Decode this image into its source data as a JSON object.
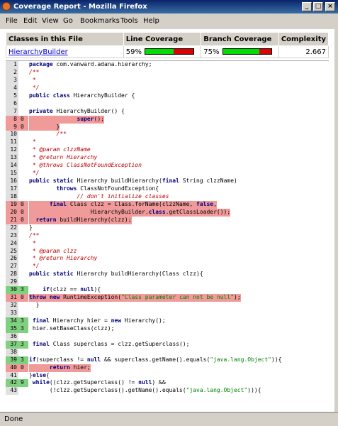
{
  "window": {
    "title": "Coverage Report - Mozilla Firefox"
  },
  "menubar": {
    "items": [
      "File",
      "Edit",
      "View",
      "Go",
      "Bookmarks",
      "Tools",
      "Help"
    ]
  },
  "summary": {
    "headers": [
      "Classes in this File",
      "Line Coverage",
      "Branch Coverage",
      "Complexity"
    ],
    "class_name": "HierarchyBuilder",
    "line_coverage": {
      "text": "59%",
      "fraction": 0.59
    },
    "branch_coverage": {
      "text": "75%",
      "fraction": 0.75
    },
    "complexity": "2.667"
  },
  "code_lines": [
    {
      "n": "1",
      "h": "",
      "s": "",
      "t": "<span class='kw'>package</span> com.vanward.adana.hierarchy;"
    },
    {
      "n": "2",
      "h": "",
      "s": "",
      "t": "<span class='cm'>/**</span>"
    },
    {
      "n": "3",
      "h": "",
      "s": "",
      "t": "<span class='cm'> *</span>"
    },
    {
      "n": "4",
      "h": "",
      "s": "",
      "t": "<span class='cm'> */</span>"
    },
    {
      "n": "5",
      "h": "",
      "s": "",
      "t": "<span class='kw'>public class</span> HierarchyBuilder {"
    },
    {
      "n": "6",
      "h": "",
      "s": "",
      "t": ""
    },
    {
      "n": "7",
      "h": "",
      "s": "",
      "t": "<span class='kw'>private</span> HierarchyBuilder() {"
    },
    {
      "n": "8",
      "h": "0",
      "s": "miss",
      "t": "              <span class='kw'>super</span>();"
    },
    {
      "n": "9",
      "h": "0",
      "s": "miss",
      "t": "        }"
    },
    {
      "n": "10",
      "h": "",
      "s": "",
      "t": "        <span class='cm'>/**</span>"
    },
    {
      "n": "11",
      "h": "",
      "s": "",
      "t": "<span class='cm'> *</span>"
    },
    {
      "n": "12",
      "h": "",
      "s": "",
      "t": "<span class='cm'> * @param clzzName</span>"
    },
    {
      "n": "13",
      "h": "",
      "s": "",
      "t": "<span class='cm'> * @return Hierarchy</span>"
    },
    {
      "n": "14",
      "h": "",
      "s": "",
      "t": "<span class='cm'> * @throws ClassNotFoundException</span>"
    },
    {
      "n": "15",
      "h": "",
      "s": "",
      "t": "<span class='cm'> */</span>"
    },
    {
      "n": "16",
      "h": "",
      "s": "",
      "t": "<span class='kw'>public static</span> Hierarchy buildHierarchy(<span class='kw'>final</span> String clzzName)"
    },
    {
      "n": "17",
      "h": "",
      "s": "",
      "t": "        <span class='kw'>throws</span> ClassNotFoundException{"
    },
    {
      "n": "18",
      "h": "",
      "s": "",
      "t": "              <span class='cm'>// don't initialize classes</span>"
    },
    {
      "n": "19",
      "h": "0",
      "s": "miss",
      "t": "      <span class='kw'>final</span> Class clzz = Class.forName(clzzName, <span class='kw'>false</span>,"
    },
    {
      "n": "20",
      "h": "0",
      "s": "miss",
      "t": "                  HierarchyBuilder.<span class='kw'>class</span>.getClassLoader());"
    },
    {
      "n": "21",
      "h": "0",
      "s": "miss",
      "t": "  <span class='kw'>return</span> buildHierarchy(clzz);"
    },
    {
      "n": "22",
      "h": "",
      "s": "",
      "t": "}"
    },
    {
      "n": "23",
      "h": "",
      "s": "",
      "t": "<span class='cm'>/**</span>"
    },
    {
      "n": "24",
      "h": "",
      "s": "",
      "t": "<span class='cm'> *</span>"
    },
    {
      "n": "25",
      "h": "",
      "s": "",
      "t": "<span class='cm'> * @param clzz</span>"
    },
    {
      "n": "26",
      "h": "",
      "s": "",
      "t": "<span class='cm'> * @return Hierarchy</span>"
    },
    {
      "n": "27",
      "h": "",
      "s": "",
      "t": "<span class='cm'> */</span>"
    },
    {
      "n": "28",
      "h": "",
      "s": "",
      "t": "<span class='kw'>public static</span> Hierarchy buildHierarchy(Class clzz){"
    },
    {
      "n": "29",
      "h": "",
      "s": "",
      "t": ""
    },
    {
      "n": "30",
      "h": "3",
      "s": "hit",
      "t": "    <span class='kw'>if</span>(clzz == <span class='kw'>null</span>){"
    },
    {
      "n": "31",
      "h": "0",
      "s": "miss",
      "t": "<span class='kw'>throw new</span> RuntimeException(<span class='st'>\"Class parameter can not be null\"</span>);"
    },
    {
      "n": "32",
      "h": "",
      "s": "",
      "t": "  }"
    },
    {
      "n": "33",
      "h": "",
      "s": "",
      "t": ""
    },
    {
      "n": "34",
      "h": "3",
      "s": "hit",
      "t": " <span class='kw'>final</span> Hierarchy hier = <span class='kw'>new</span> Hierarchy();"
    },
    {
      "n": "35",
      "h": "3",
      "s": "hit",
      "t": " hier.setBaseClass(clzz);"
    },
    {
      "n": "36",
      "h": "",
      "s": "",
      "t": ""
    },
    {
      "n": "37",
      "h": "3",
      "s": "hit",
      "t": " <span class='kw'>final</span> Class superclass = clzz.getSuperclass();"
    },
    {
      "n": "38",
      "h": "",
      "s": "",
      "t": ""
    },
    {
      "n": "39",
      "h": "3",
      "s": "hit",
      "t": "<span class='kw'>if</span>(superclass != <span class='kw'>null</span> &amp;&amp; superclass.getName().equals(<span class='st'>\"java.lang.Object\"</span>)){"
    },
    {
      "n": "40",
      "h": "0",
      "s": "miss",
      "t": "      <span class='kw'>return</span> hier;"
    },
    {
      "n": "41",
      "h": "",
      "s": "",
      "t": "}<span class='kw'>else</span>{"
    },
    {
      "n": "42",
      "h": "9",
      "s": "hit",
      "t": " <span class='kw'>while</span>((clzz.getSuperclass() != <span class='kw'>null</span>) &amp;&amp;"
    },
    {
      "n": "43",
      "h": "",
      "s": "",
      "t": "      (!clzz.getSuperclass().getName().equals(<span class='st'>\"java.lang.Object\"</span>))){"
    }
  ],
  "status": {
    "text": "Done"
  }
}
